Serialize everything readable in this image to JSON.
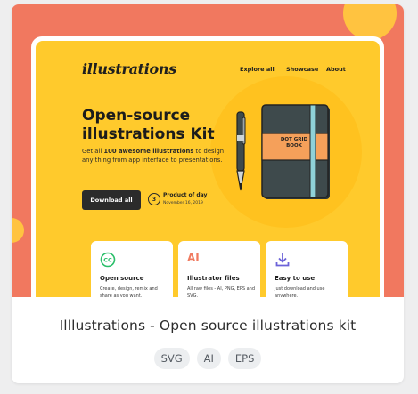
{
  "card": {
    "title": "Illlustrations - Open source illustrations kit",
    "tags": [
      "SVG",
      "AI",
      "EPS"
    ]
  },
  "preview": {
    "logo": "illustrations",
    "nav": [
      "Explore all",
      "Showcase",
      "About"
    ],
    "hero": {
      "title": "Open-source illustrations Kit",
      "sub_prefix": "Get all ",
      "sub_bold": "100 awesome illustrations",
      "sub_suffix": " to design any thing from app interface to presentations.",
      "button": "Download all",
      "badge_number": "3",
      "product_of_day": "Product of day",
      "date": "November 16, 2019"
    },
    "book_label": "DOT GRID BOOK",
    "features": [
      {
        "icon": "cc-icon",
        "icon_text": "CC",
        "title": "Open source",
        "text": "Create, design, remix and share as you want."
      },
      {
        "icon": "ai-icon",
        "icon_text": "AI",
        "title": "Illustrator files",
        "text": "All raw files - AI, PNG, EPS and SVG."
      },
      {
        "icon": "download-icon",
        "icon_text": "",
        "title": "Easy to use",
        "text": "Just download and use anywhere."
      }
    ],
    "colors": {
      "background": "#f1785f",
      "site": "#ffca2c",
      "book": "#3e4a4c",
      "band": "#f5a05a"
    }
  }
}
